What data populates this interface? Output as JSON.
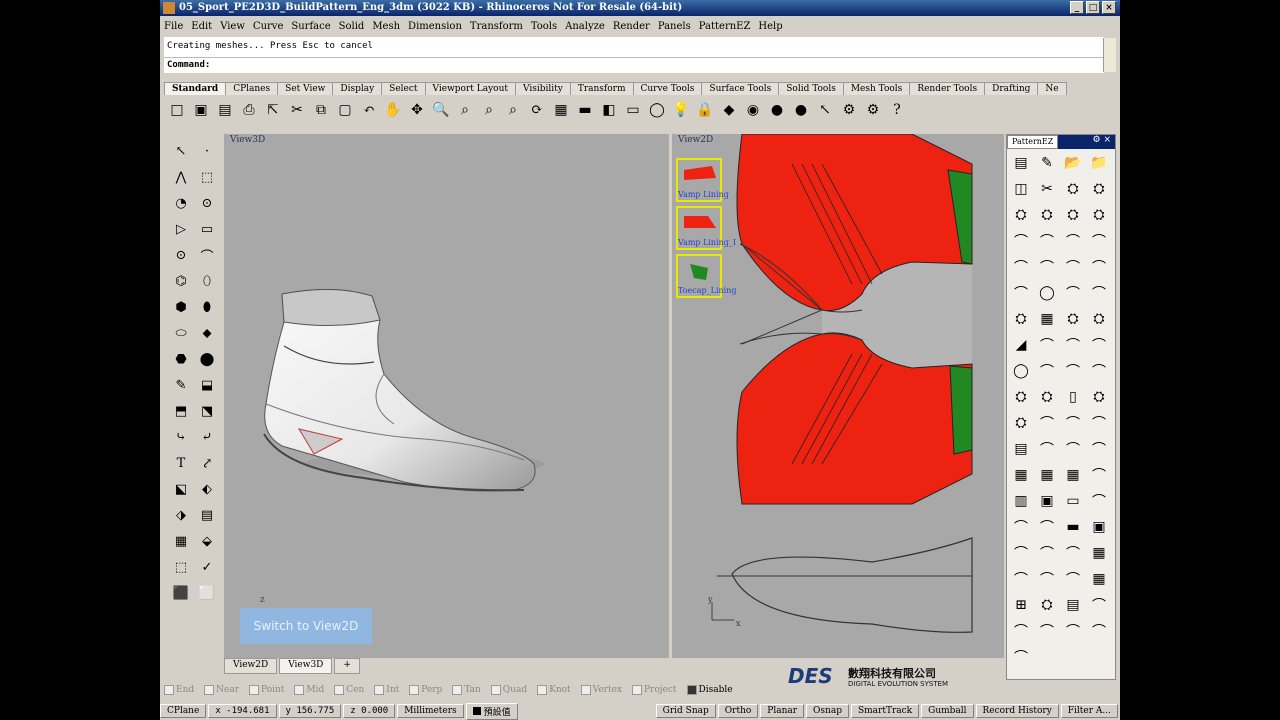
{
  "window": {
    "title": "05_Sport_PE2D3D_BuildPattern_Eng_3dm (3022 KB) - Rhinoceros Not For Resale (64-bit)"
  },
  "menu": [
    "File",
    "Edit",
    "View",
    "Curve",
    "Surface",
    "Solid",
    "Mesh",
    "Dimension",
    "Transform",
    "Tools",
    "Analyze",
    "Render",
    "Panels",
    "PatternEZ",
    "Help"
  ],
  "command": {
    "history": "Creating meshes... Press Esc to cancel",
    "prompt": "Command:"
  },
  "toolbar_tabs": [
    "Standard",
    "CPlanes",
    "Set View",
    "Display",
    "Select",
    "Viewport Layout",
    "Visibility",
    "Transform",
    "Curve Tools",
    "Surface Tools",
    "Solid Tools",
    "Mesh Tools",
    "Render Tools",
    "Drafting",
    "Ne"
  ],
  "toolbar_icons": [
    "new-icon",
    "open-icon",
    "save-icon",
    "print-icon",
    "import-icon",
    "cut-icon",
    "copy-icon",
    "paste-icon",
    "undo-icon",
    "pan-icon",
    "move-icon",
    "zoom-icon",
    "zoom-window-icon",
    "zoom-extents-icon",
    "zoom-selected-icon",
    "rotate-view-icon",
    "four-view-icon",
    "cplane-icon",
    "grid-icon",
    "rectangle-icon",
    "ellipse-icon",
    "light-icon",
    "lock-icon",
    "material-icon",
    "color-wheel-icon",
    "shade-icon",
    "render-icon",
    "select-icon",
    "settings-icon",
    "options-icon",
    "help-icon"
  ],
  "toolbar_glyphs": [
    "□",
    "▣",
    "▤",
    "⎙",
    "⇱",
    "✂",
    "⧉",
    "▢",
    "↶",
    "✋",
    "✥",
    "🔍",
    "⌕",
    "⌕",
    "⌕",
    "⟳",
    "▦",
    "▬",
    "◧",
    "▭",
    "◯",
    "💡",
    "🔒",
    "◆",
    "◉",
    "●",
    "●",
    "↖",
    "⚙",
    "⚙",
    "?"
  ],
  "viewports": {
    "left": {
      "label": "View3D",
      "switch_label": "Switch to View2D",
      "axis_label": "z"
    },
    "right": {
      "label": "View2D",
      "axis_x": "x",
      "axis_y": "y"
    }
  },
  "pattern_thumbs": [
    "Vamp Lining",
    "Vamp Lining_I",
    "Toecap_Lining"
  ],
  "viewport_tabs": [
    "View2D",
    "View3D",
    "+"
  ],
  "panel": {
    "title": "PatternEZ",
    "icons": [
      "▤",
      "✎",
      "📂",
      "📁",
      "◫",
      "✂",
      "⛭",
      "⛭",
      "⛭",
      "⛭",
      "⛭",
      "⛭",
      "⌒",
      "⌒",
      "⌒",
      "⌒",
      "⌒",
      "⌒",
      "⌒",
      "⌒",
      "⌒",
      "◯",
      "⌒",
      "⌒",
      "⛭",
      "▦",
      "⛭",
      "⛭",
      "◢",
      "⌒",
      "⌒",
      "⌒",
      "◯",
      "⌒",
      "⌒",
      "⌒",
      "⛭",
      "⛭",
      "▯",
      "⛭",
      "⛭",
      "⌒",
      "⌒",
      "⌒",
      "▤",
      "⌒",
      "⌒",
      "⌒",
      "▦",
      "▦",
      "▦",
      "⌒",
      "▥",
      "▣",
      "▭",
      "⌒",
      "⌒",
      "⌒",
      "▬",
      "▣",
      "⌒",
      "⌒",
      "⌒",
      "▦",
      "⌒",
      "⌒",
      "⌒",
      "▦",
      "⊞",
      "⛭",
      "▤",
      "⌒",
      "⌒",
      "⌒",
      "⌒",
      "⌒",
      "⌒"
    ]
  },
  "logo": {
    "mark": "DES",
    "chinese": "數翔科技有限公司",
    "english": "DIGITAL EVOLUTION SYSTEM"
  },
  "osnaps": [
    {
      "label": "End",
      "on": false
    },
    {
      "label": "Near",
      "on": false
    },
    {
      "label": "Point",
      "on": false
    },
    {
      "label": "Mid",
      "on": false
    },
    {
      "label": "Cen",
      "on": false
    },
    {
      "label": "Int",
      "on": false
    },
    {
      "label": "Perp",
      "on": false
    },
    {
      "label": "Tan",
      "on": false
    },
    {
      "label": "Quad",
      "on": false
    },
    {
      "label": "Knot",
      "on": false
    },
    {
      "label": "Vertex",
      "on": false
    },
    {
      "label": "Project",
      "on": false
    },
    {
      "label": "Disable",
      "on": true
    }
  ],
  "status": {
    "cplane": "CPlane",
    "x": "x -194.681",
    "y": "y 156.775",
    "z": "z 0.000",
    "units": "Millimeters",
    "layer": "預設值",
    "toggles": [
      "Grid Snap",
      "Ortho",
      "Planar",
      "Osnap",
      "SmartTrack",
      "Gumball",
      "Record History",
      "Filter A..."
    ]
  },
  "colors": {
    "title_bar": "#0a246a",
    "upper_red": "#ee2211",
    "accent_green": "#228822",
    "viewport_bg": "#a8a8a8"
  }
}
